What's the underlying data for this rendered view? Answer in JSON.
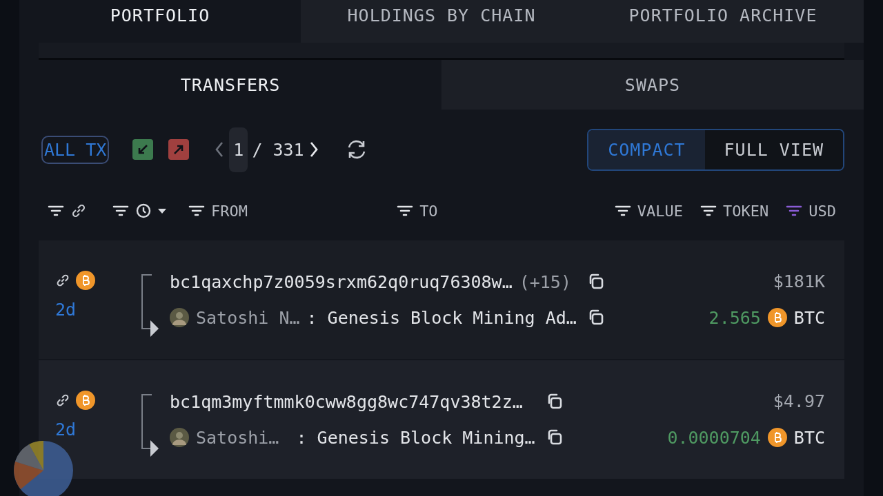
{
  "top_tabs": [
    {
      "label": "PORTFOLIO",
      "selected": true
    },
    {
      "label": "HOLDINGS BY CHAIN",
      "selected": false
    },
    {
      "label": "PORTFOLIO ARCHIVE",
      "selected": false
    }
  ],
  "sub_tabs": [
    {
      "label": "TRANSFERS",
      "selected": true
    },
    {
      "label": "SWAPS",
      "selected": false
    }
  ],
  "toolbar": {
    "filter": {
      "label": "ALL TX",
      "selected": true
    },
    "page": "1",
    "page_total": "/ 331"
  },
  "view_toggle": [
    {
      "label": "COMPACT",
      "selected": true
    },
    {
      "label": "FULL VIEW",
      "selected": false
    }
  ],
  "columns": [
    {
      "kind": "link",
      "filter_active": false
    },
    {
      "kind": "time",
      "filter_active": false
    },
    {
      "kind": "text",
      "label": "FROM",
      "filter_active": false
    },
    {
      "kind": "text",
      "label": "TO",
      "filter_active": false
    },
    {
      "kind": "text",
      "label": "VALUE",
      "filter_active": false
    },
    {
      "kind": "text",
      "label": "TOKEN",
      "filter_active": false
    },
    {
      "kind": "text",
      "label": "USD",
      "filter_active": true
    }
  ],
  "rows": [
    {
      "time": "2d",
      "from": "bc1qaxchp7z0059srxm62q0ruq76308w…",
      "from_extra": "(+15)",
      "to_name": "Satoshi N…",
      "to_label": ": Genesis Block Mining Ad…",
      "usd": "$181K",
      "amount": "2.565",
      "token": "BTC"
    },
    {
      "time": "2d",
      "from": "bc1qm3myftmmk0cww8gg8wc747qv38t2z…",
      "to_name": "Satoshi…",
      "to_label": " : Genesis Block Mining…",
      "usd": "$4.97",
      "amount": "0.0000704",
      "token": "BTC"
    }
  ]
}
